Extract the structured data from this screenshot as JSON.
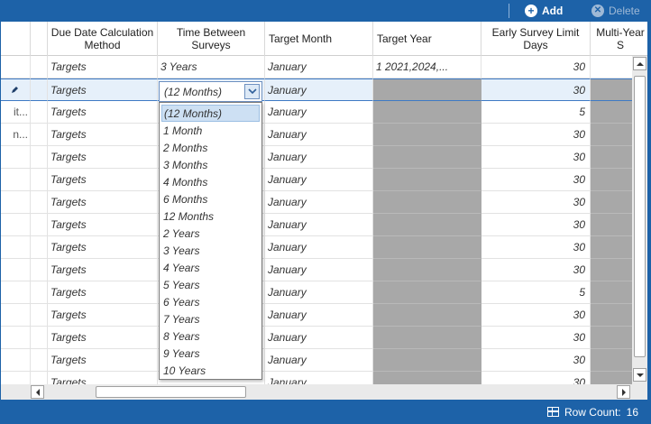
{
  "toolbar": {
    "add_label": "Add",
    "delete_label": "Delete"
  },
  "columns": {
    "due_date_method": "Due Date Calculation Method",
    "time_between": "Time Between Surveys",
    "target_month": "Target Month",
    "target_year": "Target Year",
    "early_limit": "Early Survey Limit Days",
    "multi_year": "Multi-Year S"
  },
  "rows": [
    {
      "indicator": "",
      "method": "Targets",
      "time": "3 Years",
      "month": "January",
      "year": "1    2021,2024,...",
      "days": "30"
    },
    {
      "indicator": "edit",
      "method": "Targets",
      "time": "",
      "month": "January",
      "year": "",
      "days": "30"
    },
    {
      "indicator": "it...",
      "method": "Targets",
      "time": "",
      "month": "January",
      "year": "",
      "days": "5"
    },
    {
      "indicator": "n...",
      "method": "Targets",
      "time": "",
      "month": "January",
      "year": "",
      "days": "30"
    },
    {
      "indicator": "",
      "method": "Targets",
      "time": "",
      "month": "January",
      "year": "",
      "days": "30"
    },
    {
      "indicator": "",
      "method": "Targets",
      "time": "",
      "month": "January",
      "year": "",
      "days": "30"
    },
    {
      "indicator": "",
      "method": "Targets",
      "time": "",
      "month": "January",
      "year": "",
      "days": "30"
    },
    {
      "indicator": "",
      "method": "Targets",
      "time": "",
      "month": "January",
      "year": "",
      "days": "30"
    },
    {
      "indicator": "",
      "method": "Targets",
      "time": "",
      "month": "January",
      "year": "",
      "days": "30"
    },
    {
      "indicator": "",
      "method": "Targets",
      "time": "",
      "month": "January",
      "year": "",
      "days": "30"
    },
    {
      "indicator": "",
      "method": "Targets",
      "time": "",
      "month": "January",
      "year": "",
      "days": "5"
    },
    {
      "indicator": "",
      "method": "Targets",
      "time": "",
      "month": "January",
      "year": "",
      "days": "30"
    },
    {
      "indicator": "",
      "method": "Targets",
      "time": "",
      "month": "January",
      "year": "",
      "days": "30"
    },
    {
      "indicator": "",
      "method": "Targets",
      "time": "",
      "month": "January",
      "year": "",
      "days": "30"
    },
    {
      "indicator": "",
      "method": "Targets",
      "time": "",
      "month": "January",
      "year": "",
      "days": "30"
    }
  ],
  "editor": {
    "selected": "(12 Months)",
    "options": [
      "(12 Months)",
      "1 Month",
      "2 Months",
      "3 Months",
      "4 Months",
      "6 Months",
      "12 Months",
      "2 Years",
      "3 Years",
      "4 Years",
      "5 Years",
      "6 Years",
      "7 Years",
      "8 Years",
      "9 Years",
      "10 Years"
    ]
  },
  "status": {
    "row_count_label": "Row Count:",
    "row_count": "16"
  },
  "colors": {
    "accent": "#1d62a8",
    "disabled_cell": "#a8a8a8",
    "selected_row": "#e6f0fa"
  }
}
